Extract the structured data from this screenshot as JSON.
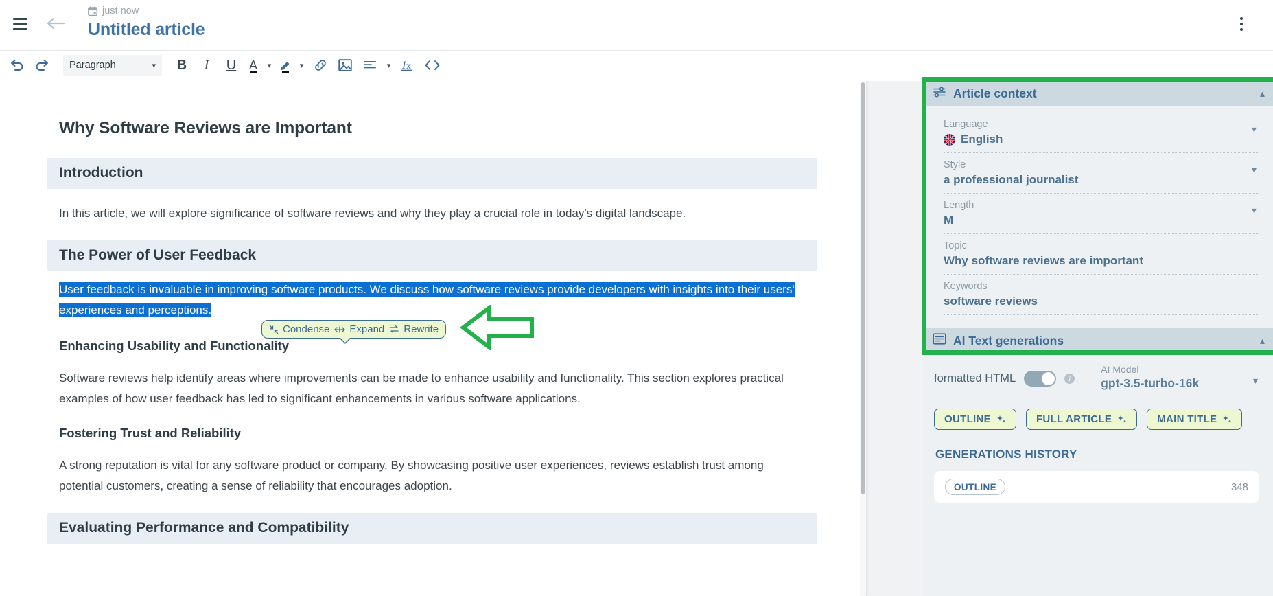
{
  "topbar": {
    "timestamp": "just now",
    "title": "Untitled article",
    "menu_icon": "hamburger-icon",
    "back_icon": "back-arrow-icon",
    "calendar_icon": "calendar-icon",
    "more_icon": "kebab-menu-icon"
  },
  "toolbar": {
    "undo": "undo-icon",
    "redo": "redo-icon",
    "style_select": "Paragraph",
    "bold": "B",
    "italic": "I",
    "underline": "U",
    "font_color": "A",
    "highlight": "highlighter-icon",
    "link": "link-icon",
    "image": "image-icon",
    "align": "align-left-icon",
    "clear_format": "clear-format-icon",
    "source_code": "</>"
  },
  "document": {
    "h1": "Why Software Reviews are Important",
    "section1_heading": "Introduction",
    "para1": "In this article, we will explore significance of software reviews and why they play a crucial role in today's digital landscape.",
    "section2_heading": "The Power of User Feedback",
    "selected_text": "User feedback is invaluable in improving software products. We discuss how software reviews provide developers with insights into their users' experiences and perceptions.",
    "h3_a": "Enhancing Usability and Functionality",
    "para_a": "Software reviews help identify areas where improvements can be made to enhance usability and functionality. This section explores practical examples of how user feedback has led to significant enhancements in various software applications.",
    "h3_b": "Fostering Trust and Reliability",
    "para_b": "A strong reputation is vital for any software product or company. By showcasing positive user experiences, reviews establish trust among potential customers, creating a sense of reliability that encourages adoption.",
    "section3_heading": "Evaluating Performance and Compatibility"
  },
  "ai_bubble": {
    "condense": "Condense",
    "expand": "Expand",
    "rewrite": "Rewrite"
  },
  "article_context": {
    "title": "Article context",
    "icon": "sliders-icon",
    "fields": [
      {
        "label": "Language",
        "value": "English",
        "flag": "uk-flag-icon"
      },
      {
        "label": "Style",
        "value": "a professional journalist"
      },
      {
        "label": "Length",
        "value": "M"
      },
      {
        "label": "Topic",
        "value": "Why software reviews are important"
      },
      {
        "label": "Keywords",
        "value": "software reviews"
      }
    ]
  },
  "ai_text_generations": {
    "title": "AI Text generations",
    "icon": "document-lines-icon",
    "toggle_label": "formatted HTML",
    "toggle_on": true,
    "model_label": "AI Model",
    "model_value": "gpt-3.5-turbo-16k",
    "buttons": [
      "OUTLINE",
      "FULL ARTICLE",
      "MAIN TITLE"
    ],
    "history_title": "GENERATIONS HISTORY",
    "history": [
      {
        "pill": "OUTLINE",
        "count": "348"
      }
    ]
  },
  "colors": {
    "accent_blue": "#3d6b93",
    "annotation_green": "#22b14c",
    "selection_blue": "#0b70d1",
    "button_green_bg": "#edf7d2"
  }
}
